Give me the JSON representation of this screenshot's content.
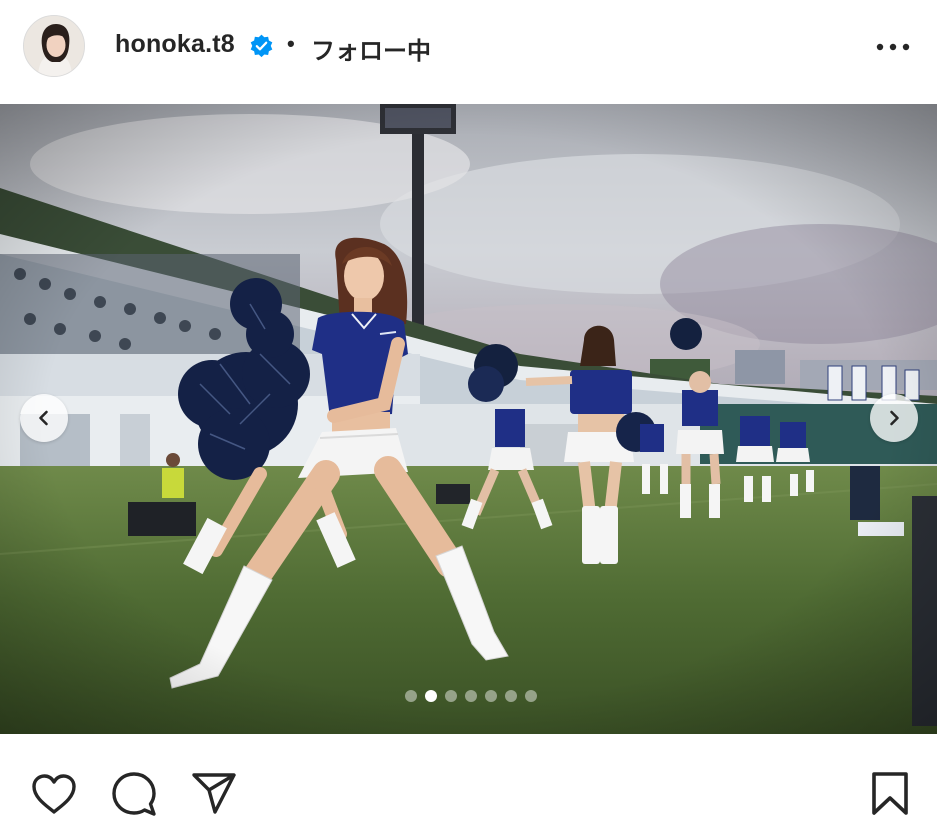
{
  "post": {
    "username": "honoka.t8",
    "verified": true,
    "separator": "•",
    "follow_state": "フォロー中",
    "more_icon": "more-horizontal-icon"
  },
  "carousel": {
    "slide_count": 7,
    "active_index": 1,
    "prev_icon": "chevron-left-icon",
    "next_icon": "chevron-right-icon"
  },
  "actions": {
    "like_icon": "heart-icon",
    "comment_icon": "comment-bubble-icon",
    "share_icon": "paper-plane-icon",
    "save_icon": "bookmark-icon"
  },
  "colors": {
    "verified_badge": "#0095f6",
    "text": "#262626",
    "uniform_navy": "#1f2f86"
  }
}
